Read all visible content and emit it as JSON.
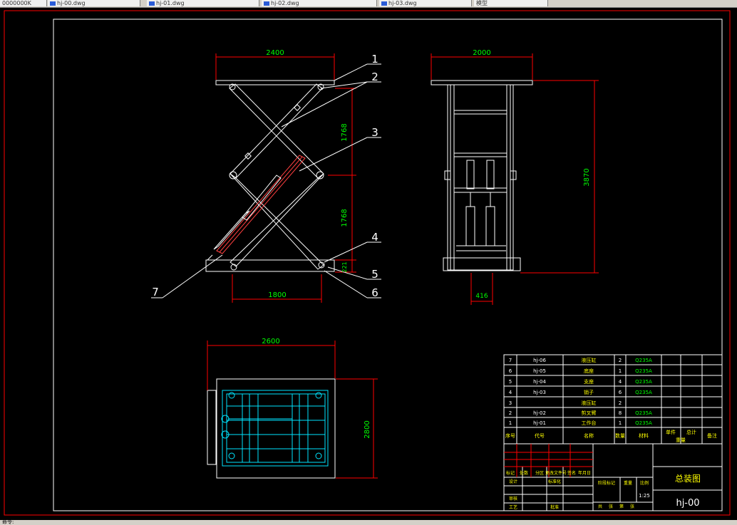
{
  "tabs": [
    {
      "label": "0000000K"
    },
    {
      "label": "hj-00.dwg"
    },
    {
      "label": "hj-01.dwg"
    },
    {
      "label": "hj-02.dwg"
    },
    {
      "label": "hj-03.dwg"
    },
    {
      "label": "模型"
    }
  ],
  "dimensions": {
    "side_top_width": "2400",
    "side_upper_height": "1768",
    "side_lower_height": "1768",
    "side_base_height": "221",
    "side_base_width": "1800",
    "front_top_width": "2000",
    "front_total_height": "3870",
    "front_cylinder_gap": "416",
    "plan_width": "2600",
    "plan_depth": "2800"
  },
  "balloons": [
    "1",
    "2",
    "3",
    "4",
    "5",
    "6",
    "7"
  ],
  "bom": {
    "rows": [
      {
        "no": "7",
        "code": "hj-06",
        "name": "液压缸",
        "qty": "2",
        "material": "Q235A"
      },
      {
        "no": "6",
        "code": "hj-05",
        "name": "底座",
        "qty": "1",
        "material": "Q235A"
      },
      {
        "no": "5",
        "code": "hj-04",
        "name": "支座",
        "qty": "4",
        "material": "Q235A"
      },
      {
        "no": "4",
        "code": "hj-03",
        "name": "销子",
        "qty": "6",
        "material": "Q235A"
      },
      {
        "no": "3",
        "code": "",
        "name": "液压缸",
        "qty": "2",
        "material": ""
      },
      {
        "no": "2",
        "code": "hj-02",
        "name": "剪叉臂",
        "qty": "8",
        "material": "Q235A"
      },
      {
        "no": "1",
        "code": "hj-01",
        "name": "工作台",
        "qty": "1",
        "material": "Q235A"
      }
    ],
    "header": {
      "no": "序号",
      "code": "代号",
      "name": "名称",
      "qty": "数量",
      "material": "材料",
      "unit": "单件",
      "total": "总计",
      "weight": "重量",
      "note": "备注"
    }
  },
  "title_block": {
    "drawing_title": "总装图",
    "drawing_code": "hj-00",
    "scale": "1:25",
    "labels": [
      "标记",
      "处数",
      "分区",
      "更改文件号",
      "签名",
      "年月日",
      "设计",
      "标准化",
      "审核",
      "工艺",
      "批准",
      "阶段标记",
      "重量",
      "比例",
      "共",
      "张",
      "第",
      "张"
    ]
  },
  "status": {
    "text": "命令:"
  }
}
